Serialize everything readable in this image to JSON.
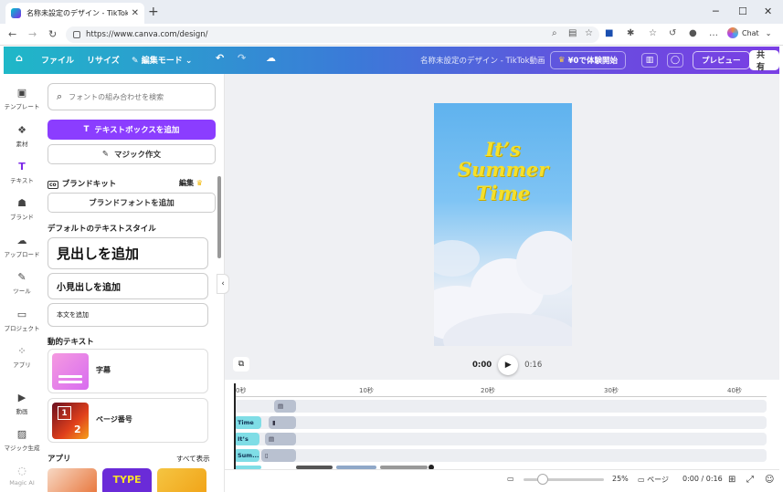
{
  "browser": {
    "tab_title": "名称未設定のデザイン - TikTok動画",
    "url": "https://www.canva.com/design/",
    "chat_label": "Chat"
  },
  "toolbar": {
    "file": "ファイル",
    "resize": "リサイズ",
    "edit_mode": "編集モード",
    "doc_title": "名称未設定のデザイン - TikTok動画",
    "trial": "¥0で体験開始",
    "preview": "プレビュー",
    "share": "共有"
  },
  "rail": {
    "items": [
      {
        "label": "テンプレート",
        "icon": "template-icon"
      },
      {
        "label": "素材",
        "icon": "elements-icon"
      },
      {
        "label": "テキスト",
        "icon": "text-icon"
      },
      {
        "label": "ブランド",
        "icon": "brand-icon"
      },
      {
        "label": "アップロード",
        "icon": "upload-icon"
      },
      {
        "label": "ツール",
        "icon": "tools-icon"
      },
      {
        "label": "プロジェクト",
        "icon": "folder-icon"
      },
      {
        "label": "アプリ",
        "icon": "apps-icon"
      },
      {
        "label": "動画",
        "icon": "video-icon"
      },
      {
        "label": "マジック生成",
        "icon": "magic-media-icon"
      },
      {
        "label": "Magic AI",
        "icon": "ai-icon"
      }
    ]
  },
  "panel": {
    "search_placeholder": "フォントの組み合わせを検索",
    "add_textbox": "テキストボックスを追加",
    "magic_write": "マジック作文",
    "brand_kit": "ブランドキット",
    "brand_edit": "編集",
    "add_brand_font": "ブランドフォントを追加",
    "default_styles": "デフォルトのテキストスタイル",
    "heading": "見出しを追加",
    "subheading": "小見出しを追加",
    "body": "本文を追加",
    "dynamic_text": "動的テキスト",
    "captions": "字幕",
    "page_number": "ページ番号",
    "page_number_digits": [
      "1",
      "2"
    ],
    "apps": "アプリ",
    "show_all": "すべて表示",
    "app_tile_text": "TYPE"
  },
  "design": {
    "lines": [
      "It’s",
      "Summer",
      "Time"
    ]
  },
  "player": {
    "current": "0:00",
    "total": "0:16"
  },
  "timeline": {
    "ticks": [
      "0秒",
      "10秒",
      "20秒",
      "30秒",
      "40秒"
    ],
    "clips": [
      "Time",
      "It’s",
      "Sum..."
    ]
  },
  "bottom": {
    "zoom": "25%",
    "page_label": "ページ",
    "time": "0:00 / 0:16",
    "zoom_level": 0.25
  },
  "colors": {
    "accent": "#8b3dff",
    "design_text": "#f5e02c"
  }
}
